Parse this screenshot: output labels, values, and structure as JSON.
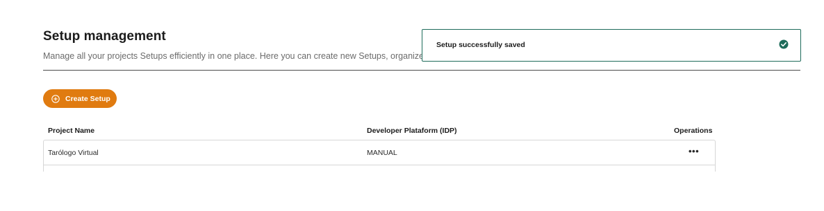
{
  "header": {
    "title": "Setup management",
    "description": "Manage all your projects Setups efficiently in one place. Here you can create new Setups, organize and m"
  },
  "toolbar": {
    "create_label": "Create Setup"
  },
  "table": {
    "columns": {
      "project": "Project Name",
      "platform": "Developer Plataform (IDP)",
      "operations": "Operations"
    },
    "rows": [
      {
        "project": "Tarólogo Virtual",
        "platform": "MANUAL",
        "operations": "•••"
      }
    ]
  },
  "toast": {
    "message": "Setup successfully saved",
    "icon": "check-circle-icon",
    "border_color": "#1d6b5a"
  },
  "colors": {
    "accent": "#e07b10",
    "success": "#1d6b5a"
  }
}
